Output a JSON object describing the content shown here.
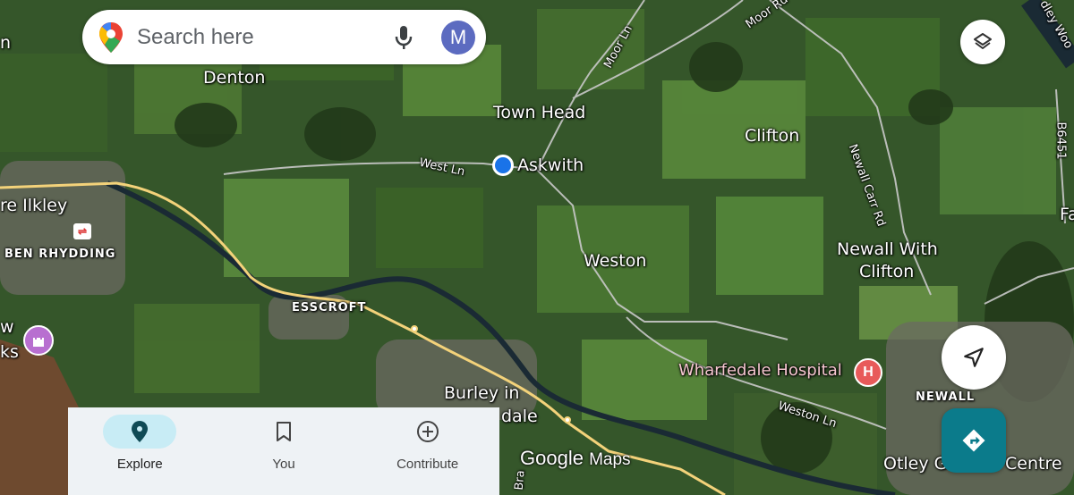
{
  "search": {
    "placeholder": "Search here",
    "avatar_letter": "M"
  },
  "map": {
    "labels": {
      "denton": "Denton",
      "town_head": "Town Head",
      "askwith": "Askwith",
      "clifton": "Clifton",
      "ilkley": "re Ilkley",
      "ben_rhydding": "BEN RHYDDING",
      "weston": "Weston",
      "newall_with_clifton_1": "Newall With",
      "newall_with_clifton_2": "Clifton",
      "esscroft": "ESSCROFT",
      "burley_1": "Burley in",
      "burley_2": "dale",
      "wharfedale_hospital": "Wharfedale Hospital",
      "newall": "NEWALL",
      "otley": "Otley G",
      "centre": "Centre",
      "west_ln": "West Ln",
      "moor_ln": "Moor Ln",
      "moor_rd": "Moor Rd",
      "newall_carr_rd": "Newall Carr Rd",
      "weston_ln": "Weston Ln",
      "b6451": "B6451",
      "partial_n": "n",
      "partial_fa": "Fa",
      "partial_w": "w",
      "partial_ks": "ks",
      "partial_woo": "dley Woo",
      "partial_bra": "Bra"
    },
    "hospital_marker": "H",
    "rail_icon": "⇌",
    "watermark_google": "Google",
    "watermark_maps": "Maps",
    "colors": {
      "water": "#1a2a34",
      "road_main": "#f3d27a",
      "location_dot": "#1a73e8",
      "directions": "#0b7b8b"
    }
  },
  "bottom_nav": {
    "tabs": [
      {
        "label": "Explore",
        "icon": "location-pin-icon",
        "active": true
      },
      {
        "label": "You",
        "icon": "bookmark-icon",
        "active": false
      },
      {
        "label": "Contribute",
        "icon": "add-circle-icon",
        "active": false
      }
    ]
  },
  "controls": {
    "layers_icon": "layers-icon",
    "recenter_icon": "navigation-arrow-icon",
    "directions_icon": "directions-icon"
  }
}
